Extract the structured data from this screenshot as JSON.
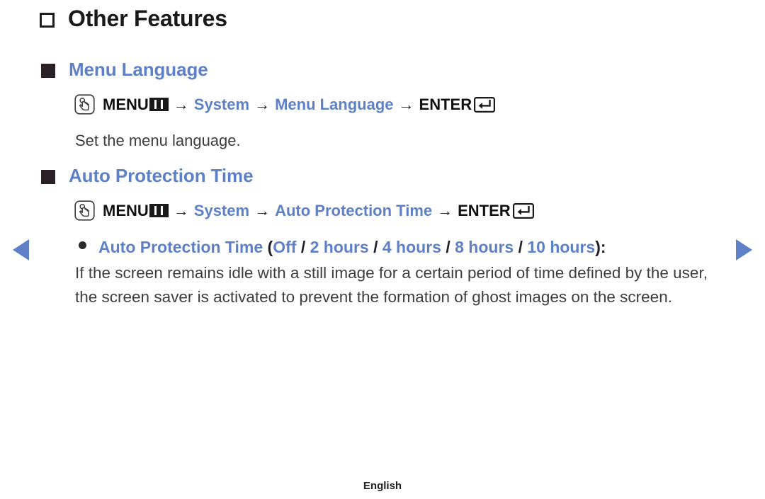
{
  "page": {
    "background_color": "#ffffff",
    "accent_blue": "#5d80c6",
    "text_color": "#3d3d3d"
  },
  "section": {
    "title": "Other Features",
    "icon": "hollow-square-icon"
  },
  "subsections": [
    {
      "title": "Menu Language",
      "icon": "solid-square-icon",
      "menu_path": {
        "press_icon": "remote-press-icon",
        "menu_label": "MENU",
        "menu_icon": "menu-grid-icon",
        "arrow": "→",
        "steps": [
          "System",
          "Menu Language"
        ],
        "enter_label": "ENTER",
        "enter_icon": "enter-return-icon"
      },
      "description": "Set the menu language."
    },
    {
      "title": "Auto Protection Time",
      "icon": "solid-square-icon",
      "menu_path": {
        "press_icon": "remote-press-icon",
        "menu_label": "MENU",
        "menu_icon": "menu-grid-icon",
        "arrow": "→",
        "steps": [
          "System",
          "Auto Protection Time"
        ],
        "enter_label": "ENTER",
        "enter_icon": "enter-return-icon"
      },
      "option": {
        "bullet": "●",
        "name": "Auto Protection Time",
        "open_paren": "(",
        "values": [
          "Off",
          "2 hours",
          "4 hours",
          "8 hours",
          "10 hours"
        ],
        "separator": "/",
        "close_paren": ")",
        "colon": ":"
      },
      "description": "If the screen remains idle with a still image for a certain period of time defined by the user, the screen saver is activated to prevent the formation of ghost images on the screen."
    }
  ],
  "nav": {
    "prev_icon": "arrow-left-icon",
    "next_icon": "arrow-right-icon"
  },
  "footer": {
    "language": "English"
  }
}
